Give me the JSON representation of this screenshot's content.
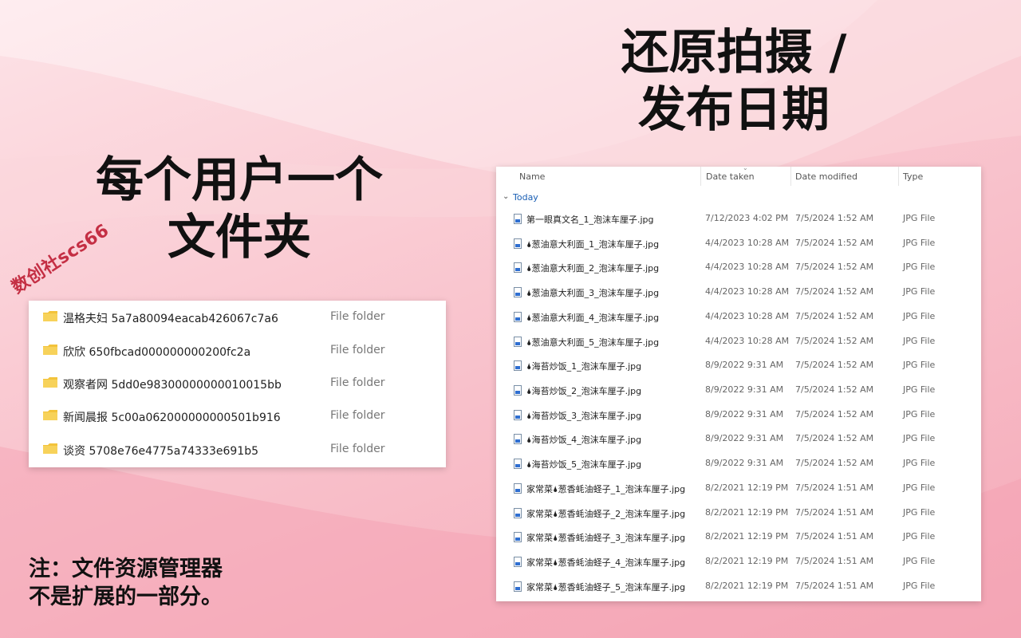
{
  "headings": {
    "right": [
      "还原拍摄 /",
      "发布日期"
    ],
    "left": [
      "每个用户一个",
      "文件夹"
    ]
  },
  "note": [
    "注：文件资源管理器",
    "不是扩展的一部分。"
  ],
  "watermark": "数创社scs66",
  "folder_list": {
    "icon": "folder-icon",
    "items": [
      {
        "name": "温格夫妇 5a7a80094eacab426067c7a6",
        "type": "File folder"
      },
      {
        "name": "欣欣 650fbcad000000000200fc2a",
        "type": "File folder"
      },
      {
        "name": "观察者网 5dd0e98300000000010015bb",
        "type": "File folder"
      },
      {
        "name": "新闻晨报 5c00a062000000000501b916",
        "type": "File folder"
      },
      {
        "name": "谈资 5708e76e4775a74333e691b5",
        "type": "File folder"
      }
    ]
  },
  "file_list": {
    "columns": {
      "name": "Name",
      "date_taken": "Date taken",
      "date_modified": "Date modified",
      "type": "Type"
    },
    "group": "Today",
    "icon": "image-file-icon",
    "items": [
      {
        "name": "第一眼真文名_1_泡沫车厘子.jpg",
        "date_taken": "7/12/2023 4:02 PM",
        "date_modified": "7/5/2024 1:52 AM",
        "type": "JPG File"
      },
      {
        "name": "🌢葱油意大利面_1_泡沫车厘子.jpg",
        "date_taken": "4/4/2023 10:28 AM",
        "date_modified": "7/5/2024 1:52 AM",
        "type": "JPG File"
      },
      {
        "name": "🌢葱油意大利面_2_泡沫车厘子.jpg",
        "date_taken": "4/4/2023 10:28 AM",
        "date_modified": "7/5/2024 1:52 AM",
        "type": "JPG File"
      },
      {
        "name": "🌢葱油意大利面_3_泡沫车厘子.jpg",
        "date_taken": "4/4/2023 10:28 AM",
        "date_modified": "7/5/2024 1:52 AM",
        "type": "JPG File"
      },
      {
        "name": "🌢葱油意大利面_4_泡沫车厘子.jpg",
        "date_taken": "4/4/2023 10:28 AM",
        "date_modified": "7/5/2024 1:52 AM",
        "type": "JPG File"
      },
      {
        "name": "🌢葱油意大利面_5_泡沫车厘子.jpg",
        "date_taken": "4/4/2023 10:28 AM",
        "date_modified": "7/5/2024 1:52 AM",
        "type": "JPG File"
      },
      {
        "name": "🌢海苔炒饭_1_泡沫车厘子.jpg",
        "date_taken": "8/9/2022 9:31 AM",
        "date_modified": "7/5/2024 1:52 AM",
        "type": "JPG File"
      },
      {
        "name": "🌢海苔炒饭_2_泡沫车厘子.jpg",
        "date_taken": "8/9/2022 9:31 AM",
        "date_modified": "7/5/2024 1:52 AM",
        "type": "JPG File"
      },
      {
        "name": "🌢海苔炒饭_3_泡沫车厘子.jpg",
        "date_taken": "8/9/2022 9:31 AM",
        "date_modified": "7/5/2024 1:52 AM",
        "type": "JPG File"
      },
      {
        "name": "🌢海苔炒饭_4_泡沫车厘子.jpg",
        "date_taken": "8/9/2022 9:31 AM",
        "date_modified": "7/5/2024 1:52 AM",
        "type": "JPG File"
      },
      {
        "name": "🌢海苔炒饭_5_泡沫车厘子.jpg",
        "date_taken": "8/9/2022 9:31 AM",
        "date_modified": "7/5/2024 1:52 AM",
        "type": "JPG File"
      },
      {
        "name": "家常菜🌢葱香蚝油蛏子_1_泡沫车厘子.jpg",
        "date_taken": "8/2/2021 12:19 PM",
        "date_modified": "7/5/2024 1:51 AM",
        "type": "JPG File"
      },
      {
        "name": "家常菜🌢葱香蚝油蛏子_2_泡沫车厘子.jpg",
        "date_taken": "8/2/2021 12:19 PM",
        "date_modified": "7/5/2024 1:51 AM",
        "type": "JPG File"
      },
      {
        "name": "家常菜🌢葱香蚝油蛏子_3_泡沫车厘子.jpg",
        "date_taken": "8/2/2021 12:19 PM",
        "date_modified": "7/5/2024 1:51 AM",
        "type": "JPG File"
      },
      {
        "name": "家常菜🌢葱香蚝油蛏子_4_泡沫车厘子.jpg",
        "date_taken": "8/2/2021 12:19 PM",
        "date_modified": "7/5/2024 1:51 AM",
        "type": "JPG File"
      },
      {
        "name": "家常菜🌢葱香蚝油蛏子_5_泡沫车厘子.jpg",
        "date_taken": "8/2/2021 12:19 PM",
        "date_modified": "7/5/2024 1:51 AM",
        "type": "JPG File"
      }
    ]
  }
}
